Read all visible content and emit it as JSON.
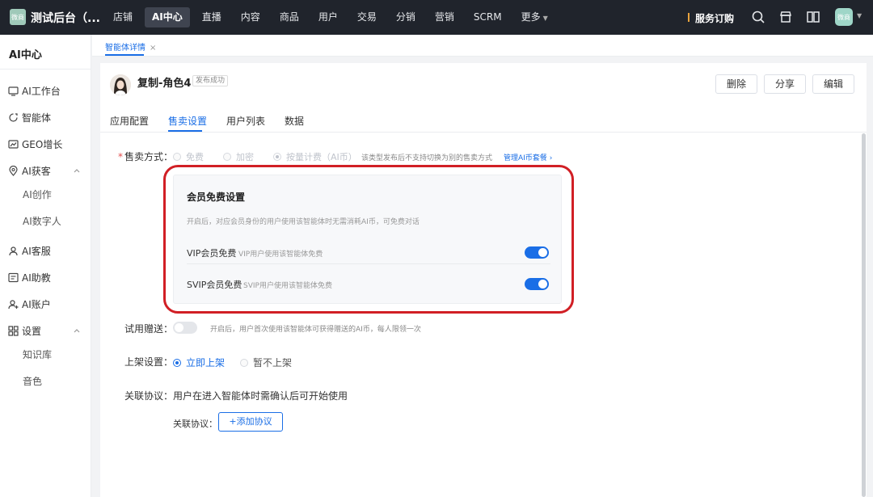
{
  "app": {
    "logo_text": "微商",
    "title": "测试后台（..."
  },
  "topnav": {
    "items": [
      "店铺",
      "AI中心",
      "直播",
      "内容",
      "商品",
      "用户",
      "交易",
      "分销",
      "营销",
      "SCRM"
    ],
    "active": "AI中心",
    "more_label": "更多",
    "subscribe_label": "服务订购",
    "avatar_text": "微商"
  },
  "sidebar": {
    "header": "AI中心",
    "items": [
      {
        "label": "AI工作台",
        "icon": "monitor-icon"
      },
      {
        "label": "智能体",
        "icon": "agent-icon"
      },
      {
        "label": "GEO增长",
        "icon": "chart-icon"
      },
      {
        "label": "AI获客",
        "icon": "location-icon"
      },
      {
        "label": "AI客服",
        "icon": "user-icon"
      },
      {
        "label": "AI助教",
        "icon": "board-icon"
      },
      {
        "label": "AI账户",
        "icon": "account-icon"
      },
      {
        "label": "设置",
        "icon": "settings-icon"
      }
    ],
    "sub_acquire": [
      "AI创作",
      "AI数字人"
    ],
    "sub_settings": [
      "知识库",
      "音色"
    ]
  },
  "page_tab": {
    "label": "智能体详情",
    "close": "×"
  },
  "agent": {
    "name": "复制-角色4",
    "status": "发布成功"
  },
  "actions": {
    "delete": "删除",
    "share": "分享",
    "edit": "编辑"
  },
  "content_tabs": [
    "应用配置",
    "售卖设置",
    "用户列表",
    "数据"
  ],
  "active_tab": "售卖设置",
  "sale": {
    "label": "售卖方式：",
    "required_mark": "*",
    "options": [
      "免费",
      "加密",
      "按量计费（AI币）"
    ],
    "selected": "按量计费（AI币）",
    "hint": "该类型发布后不支持切换为别的售卖方式",
    "manage_link": "管理AI币套餐",
    "manage_link_chevron": "›"
  },
  "member_free": {
    "title": "会员免费设置",
    "desc": "开启后，对应会员身份的用户使用该智能体时无需消耗AI币，可免费对话",
    "rows": [
      {
        "label": "VIP会员免费",
        "desc": "VIP用户使用该智能体免费",
        "enabled": true
      },
      {
        "label": "SVIP会员免费",
        "desc": "SVIP用户使用该智能体免费",
        "enabled": true
      }
    ]
  },
  "trial": {
    "label": "试用赠送：",
    "enabled": false,
    "hint": "开启后，用户首次使用该智能体可获得赠送的AI币，每人限领一次"
  },
  "listing": {
    "label": "上架设置：",
    "options": [
      "立即上架",
      "暂不上架"
    ],
    "selected": "立即上架"
  },
  "agreement": {
    "label": "关联协议：",
    "text": "用户在进入智能体时需确认后可开始使用",
    "sub_label": "关联协议：",
    "add_button": "+添加协议"
  },
  "colors": {
    "accent": "#1a6ee6",
    "topbar": "#20242c",
    "highlight": "#d11f25"
  }
}
